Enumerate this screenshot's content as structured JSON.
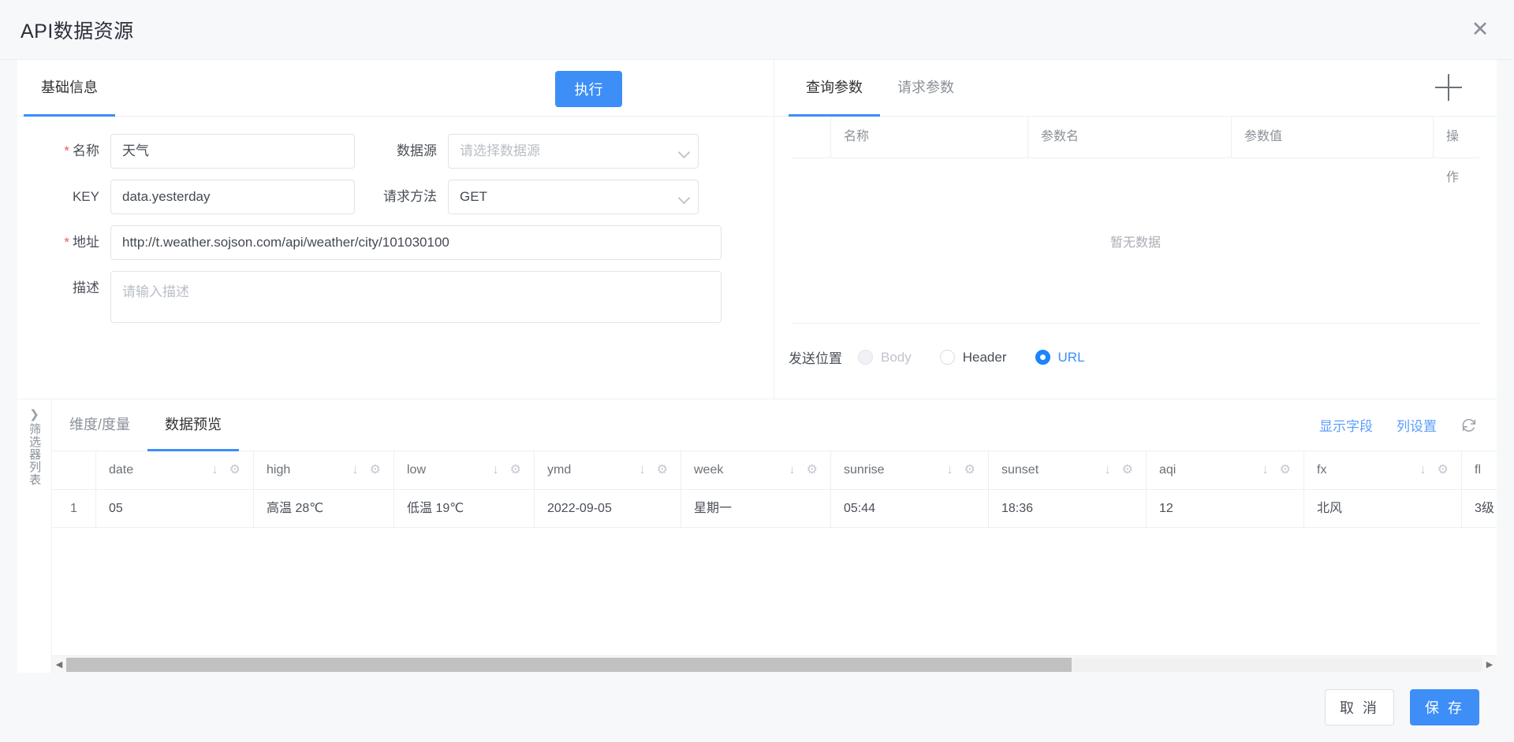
{
  "dialog": {
    "title": "API数据资源",
    "close_icon": "close-icon"
  },
  "left": {
    "tabs": [
      {
        "label": "基础信息",
        "active": true
      }
    ],
    "execute_button": "执行",
    "form": {
      "name": {
        "label": "名称",
        "required": true,
        "value": "天气"
      },
      "datasource": {
        "label": "数据源",
        "required": false,
        "value": "",
        "placeholder": "请选择数据源"
      },
      "key": {
        "label": "KEY",
        "required": false,
        "value": "data.yesterday"
      },
      "method": {
        "label": "请求方法",
        "required": false,
        "value": "GET"
      },
      "url": {
        "label": "地址",
        "required": true,
        "value": "http://t.weather.sojson.com/api/weather/city/101030100"
      },
      "description": {
        "label": "描述",
        "required": false,
        "value": "",
        "placeholder": "请输入描述"
      }
    }
  },
  "right": {
    "tabs": [
      {
        "label": "查询参数",
        "active": true
      },
      {
        "label": "请求参数",
        "active": false
      }
    ],
    "add_icon": "plus-icon",
    "table": {
      "columns": [
        "",
        "名称",
        "参数名",
        "参数值",
        "操作"
      ],
      "rows": [],
      "empty_text": "暂无数据"
    },
    "send_position": {
      "label": "发送位置",
      "options": [
        {
          "label": "Body",
          "checked": false,
          "disabled": true
        },
        {
          "label": "Header",
          "checked": false,
          "disabled": false
        },
        {
          "label": "URL",
          "checked": true,
          "disabled": false
        }
      ]
    }
  },
  "side_rail": {
    "expand_icon": "chevron-right-icon",
    "label": "筛选器列表"
  },
  "preview": {
    "tabs": [
      {
        "label": "维度/度量",
        "active": false
      },
      {
        "label": "数据预览",
        "active": true
      }
    ],
    "actions": {
      "show_fields": "显示字段",
      "column_settings": "列设置",
      "refresh_icon": "refresh-icon"
    },
    "grid": {
      "index_header": "",
      "columns": [
        {
          "key": "date",
          "label": "date",
          "sort_icon": "sort-desc-icon",
          "settings_icon": "gear-icon"
        },
        {
          "key": "high",
          "label": "high",
          "sort_icon": "sort-desc-icon",
          "settings_icon": "gear-icon"
        },
        {
          "key": "low",
          "label": "low",
          "sort_icon": "sort-desc-icon",
          "settings_icon": "gear-icon"
        },
        {
          "key": "ymd",
          "label": "ymd",
          "sort_icon": "sort-desc-icon",
          "settings_icon": "gear-icon"
        },
        {
          "key": "week",
          "label": "week",
          "sort_icon": "sort-desc-icon",
          "settings_icon": "gear-icon"
        },
        {
          "key": "sunrise",
          "label": "sunrise",
          "sort_icon": "sort-desc-icon",
          "settings_icon": "gear-icon"
        },
        {
          "key": "sunset",
          "label": "sunset",
          "sort_icon": "sort-desc-icon",
          "settings_icon": "gear-icon"
        },
        {
          "key": "aqi",
          "label": "aqi",
          "sort_icon": "sort-desc-icon",
          "settings_icon": "gear-icon"
        },
        {
          "key": "fx",
          "label": "fx",
          "sort_icon": "sort-desc-icon",
          "settings_icon": "gear-icon"
        },
        {
          "key": "fl",
          "label": "fl",
          "sort_icon": "sort-desc-icon",
          "settings_icon": "gear-icon"
        }
      ],
      "rows": [
        {
          "index": "1",
          "date": "05",
          "high": "高温 28℃",
          "low": "低温 19℃",
          "ymd": "2022-09-05",
          "week": "星期一",
          "sunrise": "05:44",
          "sunset": "18:36",
          "aqi": "12",
          "fx": "北风",
          "fl": "3级"
        }
      ]
    },
    "scrollbar": {
      "left_arrow": "◀",
      "right_arrow": "▶",
      "thumb_percent": 71
    }
  },
  "footer": {
    "cancel": "取 消",
    "save": "保 存"
  },
  "colors": {
    "accent": "#3d8ef7",
    "link": "#5b9dfc",
    "required": "#f05b5b",
    "page_bg": "#f7f8fa"
  }
}
